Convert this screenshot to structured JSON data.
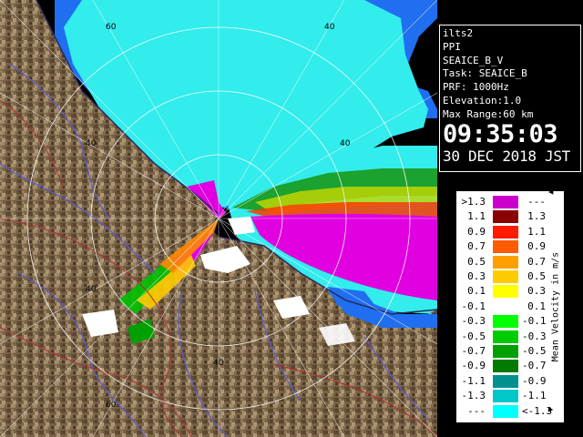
{
  "info": {
    "site": "ilts2",
    "mode": "PPI",
    "scan": "SEAICE_B_V",
    "task": "Task: SEAICE_B",
    "prf": "PRF: 1000Hz",
    "elevation": "Elevation:1.0",
    "max_range": "Max Range:60 km",
    "time": "09:35:03",
    "date": "30 DEC 2018 JST"
  },
  "range_labels": [
    "60",
    "40",
    "40",
    "40",
    "40",
    "60"
  ],
  "legend": {
    "unit": "Mean Velocity in m/s",
    "rows": [
      {
        "lo": ">1.3",
        "hi": "---",
        "color": "#cc00cc"
      },
      {
        "lo": "1.1",
        "hi": "1.3",
        "color": "#8b0000"
      },
      {
        "lo": "0.9",
        "hi": "1.1",
        "color": "#ff1a00"
      },
      {
        "lo": "0.7",
        "hi": "0.9",
        "color": "#ff5a00"
      },
      {
        "lo": "0.5",
        "hi": "0.7",
        "color": "#ff9f00"
      },
      {
        "lo": "0.3",
        "hi": "0.5",
        "color": "#ffcc00"
      },
      {
        "lo": "0.1",
        "hi": "0.3",
        "color": "#ffff00"
      },
      {
        "lo": "-0.1",
        "hi": "0.1",
        "color": "#ffffff"
      },
      {
        "lo": "-0.3",
        "hi": "-0.1",
        "color": "#00ff00"
      },
      {
        "lo": "-0.5",
        "hi": "-0.3",
        "color": "#00cc00"
      },
      {
        "lo": "-0.7",
        "hi": "-0.5",
        "color": "#00a000"
      },
      {
        "lo": "-0.9",
        "hi": "-0.7",
        "color": "#007a00"
      },
      {
        "lo": "-1.1",
        "hi": "-0.9",
        "color": "#009090"
      },
      {
        "lo": "-1.3",
        "hi": "-1.1",
        "color": "#00c8c8"
      },
      {
        "lo": "---",
        "hi": "<-1.3",
        "color": "#00ffff"
      }
    ]
  },
  "colors": {
    "terrain": "#7a6446",
    "sea_echo": "#33ecec",
    "ocean_blue": "#1f6ff0",
    "strong_receding": "#e000e0"
  }
}
